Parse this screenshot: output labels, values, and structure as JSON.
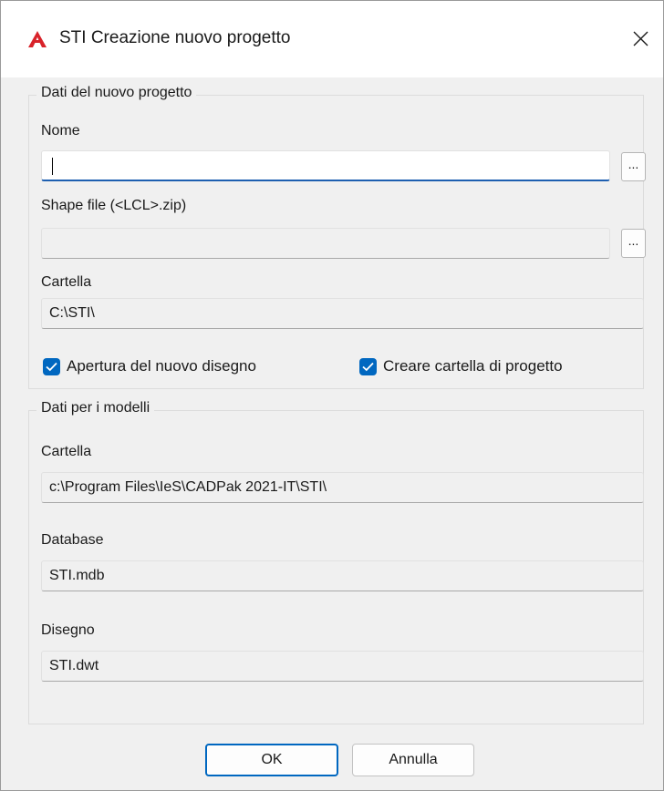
{
  "window": {
    "title": "STI Creazione nuovo progetto"
  },
  "group_project": {
    "legend": "Dati del nuovo progetto",
    "nome_label": "Nome",
    "nome_value": "",
    "shape_label": "Shape file (<LCL>.zip)",
    "shape_value": "",
    "browse_label": "...",
    "cartella_label": "Cartella",
    "cartella_value": "C:\\STI\\",
    "open_drawing_label": "Apertura del nuovo disegno",
    "open_drawing_checked": true,
    "create_folder_label": "Creare cartella di progetto",
    "create_folder_checked": true
  },
  "group_models": {
    "legend": "Dati per i modelli",
    "cartella_label": "Cartella",
    "cartella_value": "c:\\Program Files\\IeS\\CADPak 2021-IT\\STI\\",
    "database_label": "Database",
    "database_value": "STI.mdb",
    "disegno_label": "Disegno",
    "disegno_value": "STI.dwt"
  },
  "buttons": {
    "ok": "OK",
    "cancel": "Annulla"
  },
  "colors": {
    "accent": "#0067c0",
    "logo": "#d8232a"
  },
  "icons": {
    "logo": "autocad-logo-icon",
    "close": "close-icon",
    "check": "check-icon"
  }
}
